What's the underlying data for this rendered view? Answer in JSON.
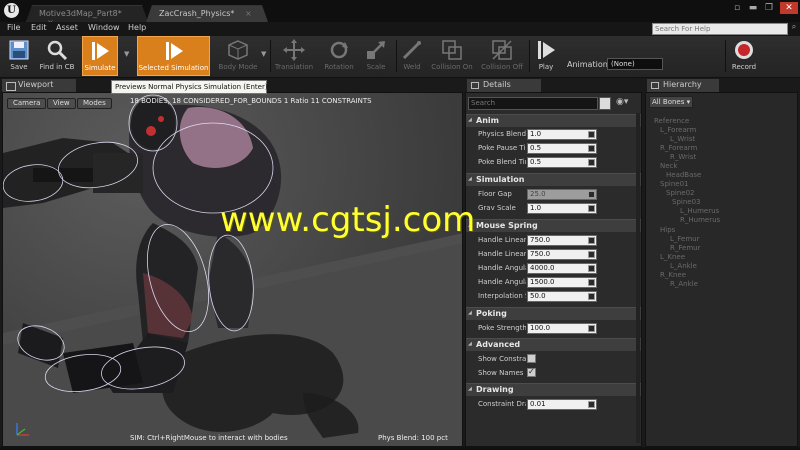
{
  "window": {
    "tabs": [
      "Motive3dMap_Part8*",
      "ZacCrash_Physics*"
    ],
    "tab_close": "×",
    "buttons": [
      "▫",
      "▬",
      "❐",
      "✕"
    ]
  },
  "menu": {
    "items": [
      "File",
      "Edit",
      "Asset",
      "Window",
      "Help"
    ],
    "help_search_placeholder": "Search For Help"
  },
  "toolbar": {
    "buttons": [
      {
        "label": "Save",
        "icon": "save-icon"
      },
      {
        "label": "Find in CB",
        "icon": "magnifier-icon"
      },
      {
        "label": "Simulate",
        "icon": "play-icon"
      },
      {
        "label": "Selected Simulation",
        "icon": "play-icon"
      },
      {
        "label": "Body Mode",
        "icon": "cube-icon"
      },
      {
        "label": "Translation",
        "icon": "move-arrows-icon"
      },
      {
        "label": "Rotation",
        "icon": "rotate-icon"
      },
      {
        "label": "Scale",
        "icon": "scale-icon"
      },
      {
        "label": "Weld",
        "icon": "weld-icon"
      },
      {
        "label": "Collision On",
        "icon": "collision-on-icon"
      },
      {
        "label": "Collision Off",
        "icon": "collision-off-icon"
      },
      {
        "label": "Play",
        "icon": "play-icon"
      },
      {
        "label": "Record",
        "icon": "record-icon"
      }
    ],
    "animation_label": "Animation:",
    "animation_value": "(None)"
  },
  "tooltip": "Previews Normal Physics Simulation (Enter)",
  "viewport": {
    "tab": "Viewport",
    "pills": [
      "Camera",
      "View",
      "Modes"
    ],
    "stats": "18 BODIES, 18 CONSIDERED_FOR_BOUNDS  1 Ratio  11 CONSTRAINTS",
    "sim_hint": "SIM: Ctrl+RightMouse to interact with bodies",
    "phys_blend": "Phys Blend: 100 pct",
    "watermark": "www.cgtsj.com"
  },
  "details": {
    "tab": "Details",
    "search_placeholder": "Search",
    "sections": [
      {
        "title": "Anim",
        "props": [
          {
            "label": "Physics Blend",
            "value": "1.0"
          },
          {
            "label": "Poke Pause Ti",
            "value": "0.5"
          },
          {
            "label": "Poke Blend Tir",
            "value": "0.5"
          }
        ]
      },
      {
        "title": "Simulation",
        "props": [
          {
            "label": "Floor Gap",
            "value": "25.0"
          },
          {
            "label": "Grav Scale",
            "value": "1.0"
          }
        ]
      },
      {
        "title": "Mouse Spring",
        "props": [
          {
            "label": "Handle Linear",
            "value": "750.0"
          },
          {
            "label": "Handle Linear",
            "value": "750.0"
          },
          {
            "label": "Handle Angula",
            "value": "4000.0"
          },
          {
            "label": "Handle Angula",
            "value": "1500.0"
          },
          {
            "label": "Interpolation S",
            "value": "50.0"
          }
        ]
      },
      {
        "title": "Poking",
        "props": [
          {
            "label": "Poke Strength",
            "value": "100.0"
          }
        ]
      },
      {
        "title": "Advanced",
        "props": [
          {
            "label": "Show Constrai",
            "value": ""
          },
          {
            "label": "Show Names i",
            "value": ""
          }
        ]
      },
      {
        "title": "Drawing",
        "props": [
          {
            "label": "Constraint Dra",
            "value": "0.01"
          }
        ]
      }
    ]
  },
  "hierarchy": {
    "tab": "Hierarchy",
    "filter": "All Bones",
    "nodes": [
      "Reference",
      "L_Forearm",
      "L_Wrist",
      "R_Forearm",
      "R_Wrist",
      "Neck",
      "HeadBase",
      "Spine01",
      "Spine02",
      "Spine03",
      "L_Humerus",
      "R_Humerus",
      "Hips",
      "L_Femur",
      "R_Femur",
      "L_Knee",
      "L_Ankle",
      "R_Knee",
      "R_Ankle"
    ]
  }
}
